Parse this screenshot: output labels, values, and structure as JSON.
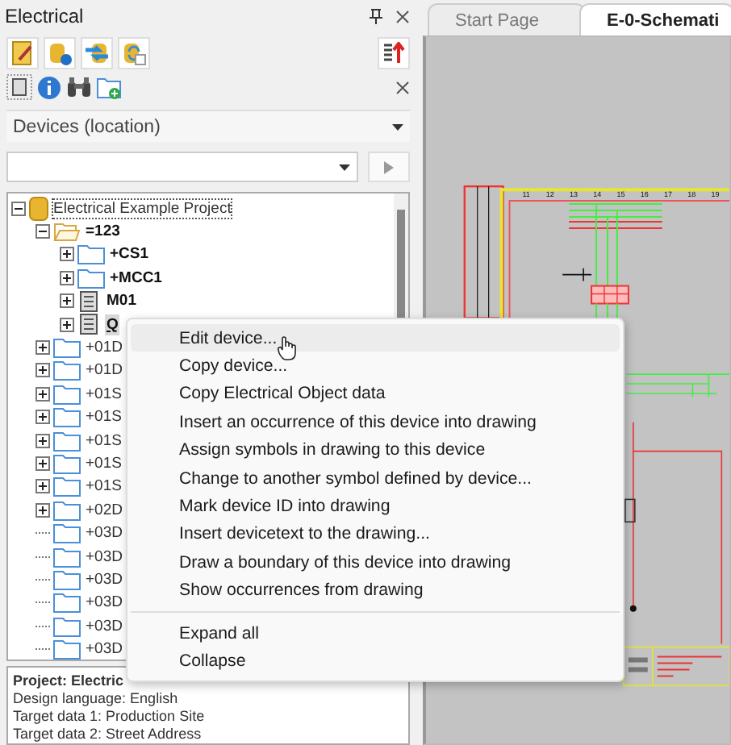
{
  "panel": {
    "title": "Electrical",
    "toolbar_1": [
      {
        "kind": "edit"
      },
      {
        "kind": "info-db"
      },
      {
        "kind": "swap-db"
      },
      {
        "kind": "refresh-db"
      }
    ],
    "view_select": {
      "value": "Devices (location)"
    },
    "tree": [
      {
        "label": "Electrical Example Project",
        "kind": "project",
        "expanded": true,
        "focused": true,
        "selected": false,
        "bold": false,
        "children": [
          {
            "label": "=123",
            "kind": "open-folder",
            "expanded": true,
            "focused": false,
            "selected": false,
            "bold": true,
            "children": [
              {
                "label": "+CS1",
                "kind": "folder",
                "expanded": false,
                "focused": false,
                "selected": false,
                "bold": true
              },
              {
                "label": "+MCC1",
                "kind": "folder",
                "expanded": false,
                "focused": false,
                "selected": false,
                "bold": true
              },
              {
                "label": "M01",
                "kind": "device",
                "expanded": false,
                "focused": false,
                "selected": false,
                "bold": true
              },
              {
                "label": "Q",
                "kind": "device",
                "expanded": false,
                "focused": false,
                "selected": true,
                "bold": true
              }
            ]
          },
          {
            "label": "+01D",
            "kind": "folder",
            "expanded": false,
            "focused": false,
            "selected": false,
            "bold": false
          },
          {
            "label": "+01D",
            "kind": "folder",
            "expanded": false,
            "focused": false,
            "selected": false,
            "bold": false
          },
          {
            "label": "+01S",
            "kind": "folder",
            "expanded": false,
            "focused": false,
            "selected": false,
            "bold": false
          },
          {
            "label": "+01S",
            "kind": "folder",
            "expanded": false,
            "focused": false,
            "selected": false,
            "bold": false
          },
          {
            "label": "+01S",
            "kind": "folder",
            "expanded": false,
            "focused": false,
            "selected": false,
            "bold": false
          },
          {
            "label": "+01S",
            "kind": "folder",
            "expanded": false,
            "focused": false,
            "selected": false,
            "bold": false
          },
          {
            "label": "+01S",
            "kind": "folder",
            "expanded": false,
            "focused": false,
            "selected": false,
            "bold": false
          },
          {
            "label": "+02D",
            "kind": "folder",
            "expanded": false,
            "focused": false,
            "selected": false,
            "bold": false
          },
          {
            "label": "+03D",
            "kind": "leaf-folder",
            "focused": false,
            "selected": false,
            "bold": false
          },
          {
            "label": "+03D",
            "kind": "leaf-folder",
            "focused": false,
            "selected": false,
            "bold": false
          },
          {
            "label": "+03D",
            "kind": "leaf-folder",
            "focused": false,
            "selected": false,
            "bold": false
          },
          {
            "label": "+03D",
            "kind": "leaf-folder",
            "focused": false,
            "selected": false,
            "bold": false
          },
          {
            "label": "+03D",
            "kind": "leaf-folder",
            "focused": false,
            "selected": false,
            "bold": false
          },
          {
            "label": "+03D",
            "kind": "leaf-folder",
            "focused": false,
            "selected": false,
            "bold": false
          }
        ]
      }
    ],
    "info": [
      {
        "text": "Project: Electric",
        "bold": true
      },
      {
        "text": "Design language: English",
        "bold": false
      },
      {
        "text": "Target data 1: Production Site",
        "bold": false
      },
      {
        "text": "Target data 2: Street Address",
        "bold": false
      }
    ]
  },
  "tabs": [
    {
      "label": "Start Page",
      "selected": false
    },
    {
      "label": "E-0-Schemati",
      "selected": true
    }
  ],
  "schematic": {
    "ruler": [
      "11",
      "12",
      "13",
      "14",
      "15",
      "16",
      "17",
      "18",
      "19"
    ]
  },
  "context_menu": [
    [
      {
        "label": "Edit device...",
        "highlighted": true
      },
      {
        "label": "Copy device...",
        "highlighted": false
      },
      {
        "label": "Copy Electrical Object data",
        "highlighted": false
      },
      {
        "label": "Insert an occurrence of this device into drawing",
        "highlighted": false
      },
      {
        "label": "Assign symbols in drawing to this device",
        "highlighted": false
      },
      {
        "label": "Change to another symbol defined by device...",
        "highlighted": false
      },
      {
        "label": "Mark device ID into drawing",
        "highlighted": false
      },
      {
        "label": "Insert devicetext to the drawing...",
        "highlighted": false
      },
      {
        "label": "Draw a boundary of this device into drawing",
        "highlighted": false
      },
      {
        "label": "Show occurrences from drawing",
        "highlighted": false
      }
    ],
    [
      {
        "label": "Expand all",
        "highlighted": false
      },
      {
        "label": "Collapse",
        "highlighted": false
      }
    ]
  ]
}
